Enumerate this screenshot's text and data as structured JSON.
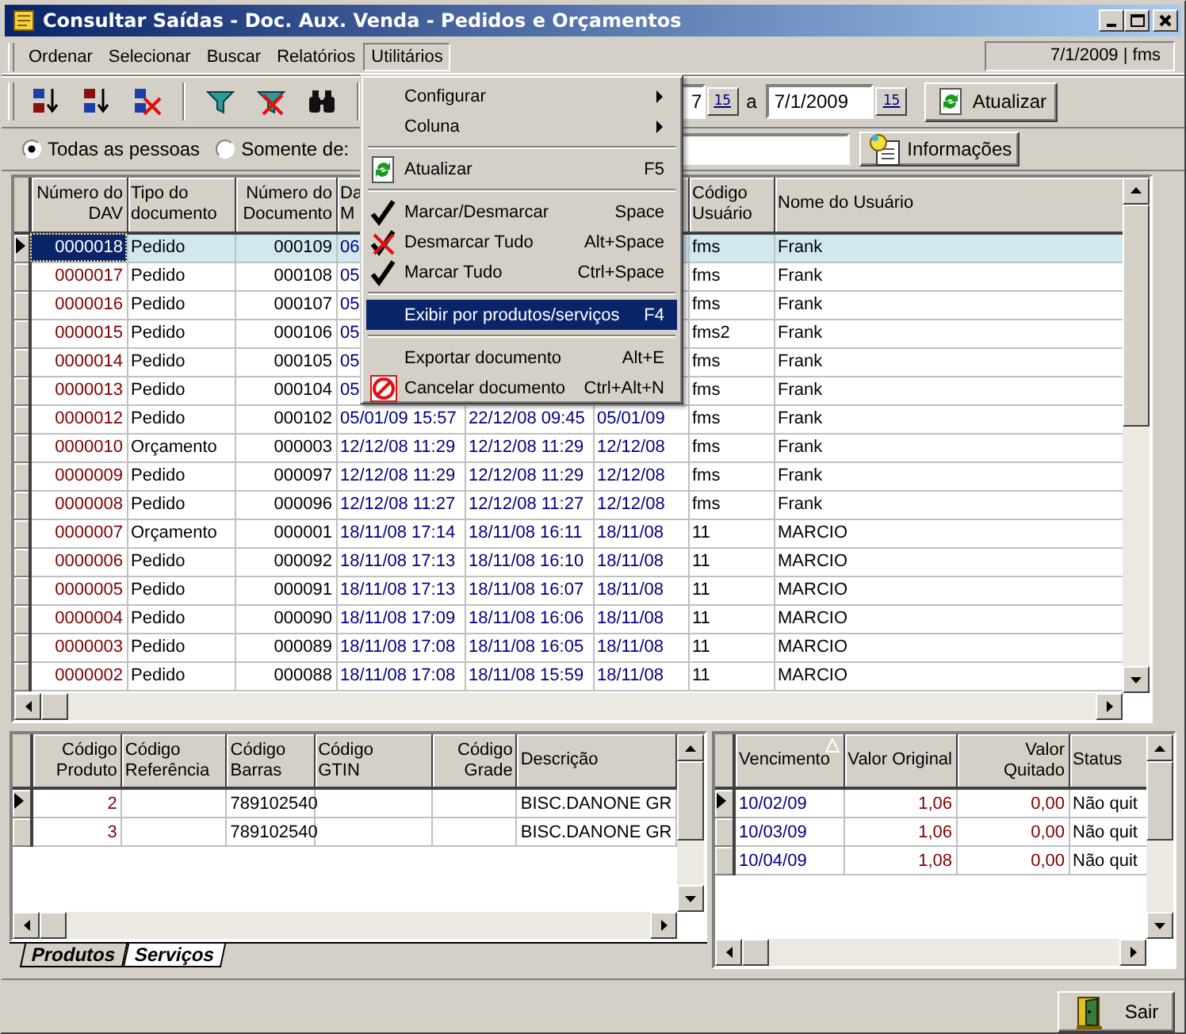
{
  "window": {
    "title": "Consultar Saídas - Doc. Aux. Venda - Pedidos e Orçamentos"
  },
  "menu_bar": [
    {
      "label": "Ordenar",
      "open": false
    },
    {
      "label": "Selecionar",
      "open": false
    },
    {
      "label": "Buscar",
      "open": false
    },
    {
      "label": "Relatórios",
      "open": false
    },
    {
      "label": "Utilitários",
      "open": true
    }
  ],
  "session_info": "7/1/2009 | fms",
  "toolbar": {
    "date_from": "7",
    "calendar_from": "15",
    "date_separator": "a",
    "date_to": "7/1/2009",
    "calendar_to": "15",
    "refresh_button": "Atualizar"
  },
  "filter": {
    "options": [
      {
        "label": "Todas as pessoas",
        "selected": true
      },
      {
        "label": "Somente de:",
        "selected": false
      }
    ],
    "info_button": "Informações"
  },
  "utilities_menu": {
    "items": [
      {
        "kind": "submenu",
        "label": "Configurar",
        "highlighted": false
      },
      {
        "kind": "submenu",
        "label": "Coluna",
        "highlighted": false
      },
      {
        "kind": "separator"
      },
      {
        "kind": "refresh",
        "label": "Atualizar",
        "shortcut": "F5",
        "highlighted": false
      },
      {
        "kind": "separator"
      },
      {
        "kind": "check",
        "label": "Marcar/Desmarcar",
        "shortcut": "Space",
        "highlighted": false
      },
      {
        "kind": "uncheck",
        "label": "Desmarcar Tudo",
        "shortcut": "Alt+Space",
        "highlighted": false
      },
      {
        "kind": "check",
        "label": "Marcar Tudo",
        "shortcut": "Ctrl+Space",
        "highlighted": false
      },
      {
        "kind": "separator"
      },
      {
        "kind": "plain",
        "label": "Exibir por produtos/serviços",
        "shortcut": "F4",
        "highlighted": true
      },
      {
        "kind": "separator"
      },
      {
        "kind": "plain",
        "label": "Exportar documento",
        "shortcut": "Alt+E",
        "highlighted": false
      },
      {
        "kind": "cancel",
        "label": "Cancelar documento",
        "shortcut": "Ctrl+Alt+N",
        "highlighted": false
      }
    ]
  },
  "documents_table": {
    "columns": [
      "Número do\nDAV",
      "Tipo do\ndocumento",
      "Número do\nDocumento",
      "Da\nM",
      null,
      null,
      "Código\nUsuário",
      "Nome do Usuário"
    ],
    "rows": [
      {
        "selected": true,
        "cells": [
          "0000018",
          "Pedido",
          "000109",
          "06",
          null,
          null,
          "fms",
          "Frank"
        ]
      },
      {
        "selected": false,
        "cells": [
          "0000017",
          "Pedido",
          "000108",
          "05",
          null,
          null,
          "fms",
          "Frank"
        ]
      },
      {
        "selected": false,
        "cells": [
          "0000016",
          "Pedido",
          "000107",
          "05",
          null,
          null,
          "fms",
          "Frank"
        ]
      },
      {
        "selected": false,
        "cells": [
          "0000015",
          "Pedido",
          "000106",
          "05",
          null,
          null,
          "fms2",
          "Frank"
        ]
      },
      {
        "selected": false,
        "cells": [
          "0000014",
          "Pedido",
          "000105",
          "05",
          null,
          null,
          "fms",
          "Frank"
        ]
      },
      {
        "selected": false,
        "cells": [
          "0000013",
          "Pedido",
          "000104",
          "05",
          null,
          null,
          "fms",
          "Frank"
        ]
      },
      {
        "selected": false,
        "cells": [
          "0000012",
          "Pedido",
          "000102",
          "05/01/09 15:57",
          "22/12/08 09:45",
          "05/01/09",
          "fms",
          "Frank"
        ]
      },
      {
        "selected": false,
        "cells": [
          "0000010",
          "Orçamento",
          "000003",
          "12/12/08 11:29",
          "12/12/08 11:29",
          "12/12/08",
          "fms",
          "Frank"
        ]
      },
      {
        "selected": false,
        "cells": [
          "0000009",
          "Pedido",
          "000097",
          "12/12/08 11:29",
          "12/12/08 11:29",
          "12/12/08",
          "fms",
          "Frank"
        ]
      },
      {
        "selected": false,
        "cells": [
          "0000008",
          "Pedido",
          "000096",
          "12/12/08 11:27",
          "12/12/08 11:27",
          "12/12/08",
          "fms",
          "Frank"
        ]
      },
      {
        "selected": false,
        "cells": [
          "0000007",
          "Orçamento",
          "000001",
          "18/11/08 17:14",
          "18/11/08 16:11",
          "18/11/08",
          "11",
          "MARCIO"
        ]
      },
      {
        "selected": false,
        "cells": [
          "0000006",
          "Pedido",
          "000092",
          "18/11/08 17:13",
          "18/11/08 16:10",
          "18/11/08",
          "11",
          "MARCIO"
        ]
      },
      {
        "selected": false,
        "cells": [
          "0000005",
          "Pedido",
          "000091",
          "18/11/08 17:13",
          "18/11/08 16:07",
          "18/11/08",
          "11",
          "MARCIO"
        ]
      },
      {
        "selected": false,
        "cells": [
          "0000004",
          "Pedido",
          "000090",
          "18/11/08 17:09",
          "18/11/08 16:06",
          "18/11/08",
          "11",
          "MARCIO"
        ]
      },
      {
        "selected": false,
        "cells": [
          "0000003",
          "Pedido",
          "000089",
          "18/11/08 17:08",
          "18/11/08 16:05",
          "18/11/08",
          "11",
          "MARCIO"
        ]
      },
      {
        "selected": false,
        "cells": [
          "0000002",
          "Pedido",
          "000088",
          "18/11/08 17:08",
          "18/11/08 15:59",
          "18/11/08",
          "11",
          "MARCIO"
        ]
      }
    ]
  },
  "items_table": {
    "columns": [
      "Código\nProduto",
      "Código\nReferência",
      "Código\nBarras",
      "Código\nGTIN",
      "Código\nGrade",
      "Descrição"
    ],
    "rows": [
      {
        "selected": true,
        "cells": [
          "2",
          null,
          "789102540",
          null,
          null,
          "BISC.DANONE GR"
        ]
      },
      {
        "selected": false,
        "cells": [
          "3",
          null,
          "789102540",
          null,
          null,
          "BISC.DANONE GR"
        ]
      }
    ],
    "tabs": [
      {
        "label": "Produtos",
        "selected": true
      },
      {
        "label": "Serviços",
        "selected": false
      }
    ]
  },
  "installments_table": {
    "columns": [
      {
        "label": "Vencimento",
        "sorted": true
      },
      {
        "label": "Valor Original",
        "sorted": false
      },
      {
        "label": "Valor Quitado",
        "sorted": false
      },
      {
        "label": "Status",
        "sorted": false
      }
    ],
    "rows": [
      {
        "selected": true,
        "cells": [
          "10/02/09",
          "1,06",
          "0,00",
          "Não quit"
        ]
      },
      {
        "selected": false,
        "cells": [
          "10/03/09",
          "1,06",
          "0,00",
          "Não quit"
        ]
      },
      {
        "selected": false,
        "cells": [
          "10/04/09",
          "1,08",
          "0,00",
          "Não quit"
        ]
      }
    ]
  },
  "exit_button": "Sair"
}
